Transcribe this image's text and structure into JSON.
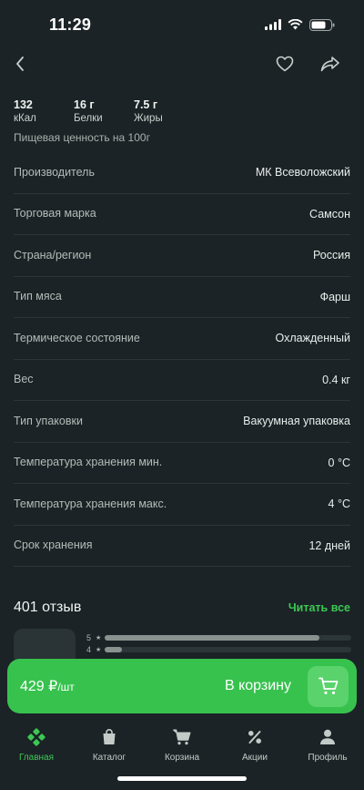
{
  "status": {
    "time": "11:29"
  },
  "nutrition": {
    "items": [
      {
        "value": "132",
        "label": "кКал"
      },
      {
        "value": "16 г",
        "label": "Белки"
      },
      {
        "value": "7.5 г",
        "label": "Жиры"
      }
    ],
    "note": "Пищевая ценность на 100г"
  },
  "properties": [
    {
      "name": "Производитель",
      "value": "МК Всеволожский"
    },
    {
      "name": "Торговая марка",
      "value": "Самсон"
    },
    {
      "name": "Страна/регион",
      "value": "Россия"
    },
    {
      "name": "Тип мяса",
      "value": "Фарш"
    },
    {
      "name": "Термическое состояние",
      "value": "Охлажденный"
    },
    {
      "name": "Вес",
      "value": "0.4 кг"
    },
    {
      "name": "Тип упаковки",
      "value": "Вакуумная упаковка"
    },
    {
      "name": "Температура хранения мин.",
      "value": "0 °C"
    },
    {
      "name": "Температура хранения макс.",
      "value": "4 °C"
    },
    {
      "name": "Срок хранения",
      "value": "12 дней"
    }
  ],
  "reviews": {
    "title": "401 отзыв",
    "read_all": "Читать все",
    "bars": [
      {
        "stars": "5",
        "fraction": 0.87
      },
      {
        "stars": "4",
        "fraction": 0.07
      }
    ]
  },
  "buy": {
    "price": "429 ₽",
    "unit": "/шт",
    "label": "В корзину"
  },
  "tabs": [
    {
      "label": "Главная",
      "icon": "home-clover-icon",
      "active": true
    },
    {
      "label": "Каталог",
      "icon": "bag-icon",
      "active": false
    },
    {
      "label": "Корзина",
      "icon": "cart-icon",
      "active": false
    },
    {
      "label": "Акции",
      "icon": "percent-icon",
      "active": false
    },
    {
      "label": "Профиль",
      "icon": "person-icon",
      "active": false
    }
  ],
  "colors": {
    "background": "#1b2326",
    "accent": "#37c24e",
    "link": "#3cc853"
  }
}
